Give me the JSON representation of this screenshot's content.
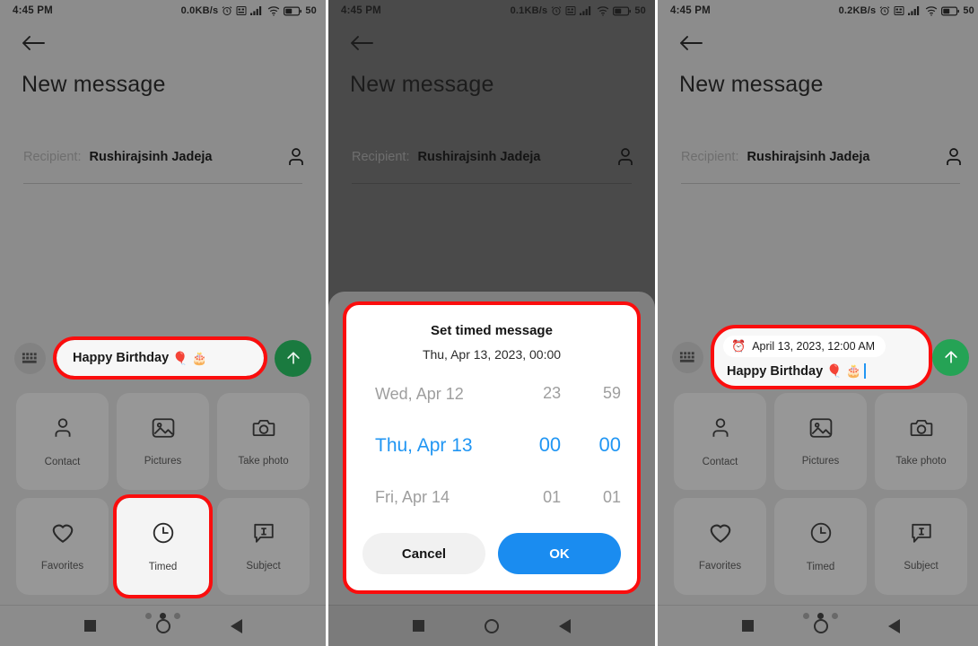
{
  "panels": [
    {
      "status": {
        "time": "4:45 PM",
        "network_speed": "0.0KB/s",
        "battery": "50"
      },
      "header": {
        "title": "New message",
        "recipient_label": "Recipient:",
        "recipient_name": "Rushirajsinh Jadeja"
      },
      "composer": {
        "text": "Happy Birthday",
        "emoji1": "🎈",
        "emoji2": "🎂"
      },
      "attachments": [
        {
          "label": "Contact",
          "icon": "person-icon"
        },
        {
          "label": "Pictures",
          "icon": "image-icon"
        },
        {
          "label": "Take photo",
          "icon": "camera-icon"
        },
        {
          "label": "Favorites",
          "icon": "heart-icon"
        },
        {
          "label": "Timed",
          "icon": "clock-icon"
        },
        {
          "label": "Subject",
          "icon": "subject-icon"
        }
      ],
      "page_dots": {
        "count": 3,
        "active": 1
      }
    },
    {
      "status": {
        "time": "4:45 PM",
        "network_speed": "0.1KB/s",
        "battery": "50"
      },
      "header": {
        "title": "New message",
        "recipient_label": "Recipient:",
        "recipient_name": "Rushirajsinh Jadeja"
      },
      "dialog": {
        "title": "Set timed message",
        "subtitle": "Thu, Apr 13, 2023, 00:00",
        "date_column": [
          "Wed, Apr 12",
          "Thu, Apr 13",
          "Fri, Apr 14"
        ],
        "hour_column": [
          "23",
          "00",
          "01"
        ],
        "minute_column": [
          "59",
          "00",
          "01"
        ],
        "selected_index": 1,
        "cancel_label": "Cancel",
        "ok_label": "OK"
      }
    },
    {
      "status": {
        "time": "4:45 PM",
        "network_speed": "0.2KB/s",
        "battery": "50"
      },
      "header": {
        "title": "New message",
        "recipient_label": "Recipient:",
        "recipient_name": "Rushirajsinh Jadeja"
      },
      "composer": {
        "timed_chip": "April 13, 2023, 12:00 AM",
        "alarm_icon": "⏰",
        "text": "Happy Birthday",
        "emoji1": "🎈",
        "emoji2": "🎂"
      },
      "attachments": [
        {
          "label": "Contact",
          "icon": "person-icon"
        },
        {
          "label": "Pictures",
          "icon": "image-icon"
        },
        {
          "label": "Take photo",
          "icon": "camera-icon"
        },
        {
          "label": "Favorites",
          "icon": "heart-icon"
        },
        {
          "label": "Timed",
          "icon": "clock-icon"
        },
        {
          "label": "Subject",
          "icon": "subject-icon"
        }
      ],
      "page_dots": {
        "count": 3,
        "active": 1
      }
    }
  ],
  "colors": {
    "highlight": "#fb0d0d",
    "send_green": "#1a7a3f",
    "send_green_bright": "#25a355",
    "accent_blue": "#2196f3",
    "ok_blue": "#1a8cf0",
    "screen_bg": "#8c8c8c"
  },
  "navbar": {
    "recents": "square-icon",
    "home": "circle-icon",
    "back": "triangle-icon"
  }
}
